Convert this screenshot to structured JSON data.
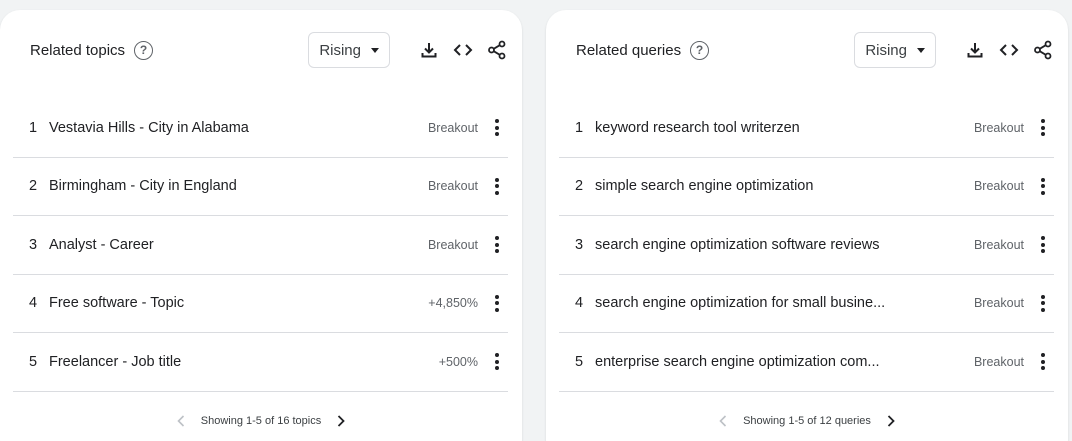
{
  "panels": [
    {
      "title": "Related topics",
      "help": "?",
      "filter": "Rising",
      "rows": [
        {
          "rank": "1",
          "label": "Vestavia Hills - City in Alabama",
          "value": "Breakout"
        },
        {
          "rank": "2",
          "label": "Birmingham - City in England",
          "value": "Breakout"
        },
        {
          "rank": "3",
          "label": "Analyst - Career",
          "value": "Breakout"
        },
        {
          "rank": "4",
          "label": "Free software - Topic",
          "value": "+4,850%"
        },
        {
          "rank": "5",
          "label": "Freelancer - Job title",
          "value": "+500%"
        }
      ],
      "pager": "Showing 1-5 of 16 topics"
    },
    {
      "title": "Related queries",
      "help": "?",
      "filter": "Rising",
      "rows": [
        {
          "rank": "1",
          "label": "keyword research tool writerzen",
          "value": "Breakout"
        },
        {
          "rank": "2",
          "label": "simple search engine optimization",
          "value": "Breakout"
        },
        {
          "rank": "3",
          "label": "search engine optimization software reviews",
          "value": "Breakout"
        },
        {
          "rank": "4",
          "label": "search engine optimization for small busine...",
          "value": "Breakout"
        },
        {
          "rank": "5",
          "label": "enterprise search engine optimization com...",
          "value": "Breakout"
        }
      ],
      "pager": "Showing 1-5 of 12 queries"
    }
  ],
  "icons": {
    "help": "help-circle-icon",
    "download": "download-icon",
    "embed": "code-icon",
    "share": "share-icon",
    "more": "more-vert-icon",
    "prev": "chevron-left-icon",
    "next": "chevron-right-icon"
  },
  "colors": {
    "background": "#f1f3f4",
    "card": "#ffffff",
    "text": "#202124",
    "muted": "#5f6368",
    "divider": "#dadce0",
    "disabled": "#bdc1c6"
  }
}
